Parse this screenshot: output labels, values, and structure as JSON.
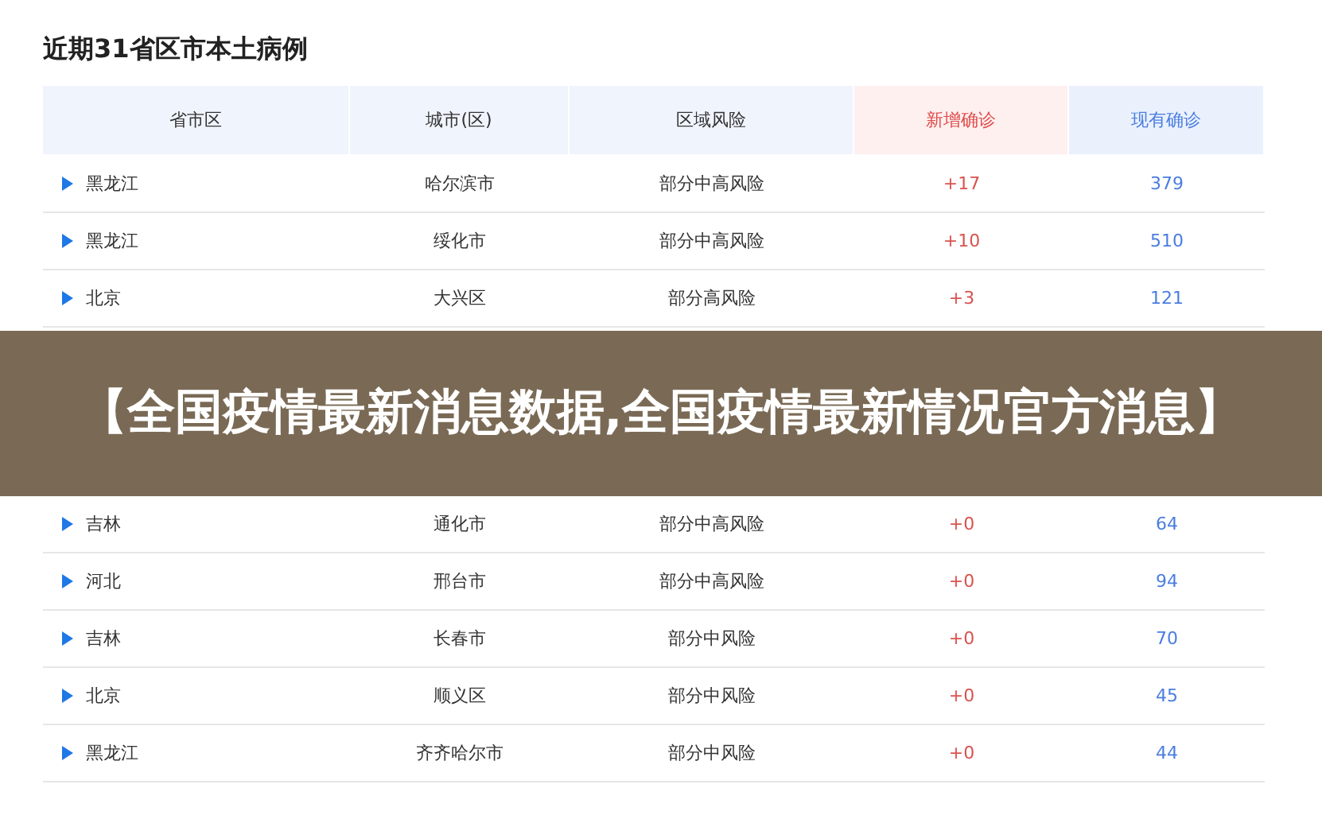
{
  "title": "近期31省区市本土病例",
  "table": {
    "columns": [
      {
        "label": "省市区",
        "kind": "plain"
      },
      {
        "label": "城市(区)",
        "kind": "plain"
      },
      {
        "label": "区域风险",
        "kind": "plain"
      },
      {
        "label": "新增确诊",
        "kind": "new"
      },
      {
        "label": "现有确诊",
        "kind": "current"
      }
    ],
    "rows": [
      {
        "province": "黑龙江",
        "city": "哈尔滨市",
        "risk": "部分中高风险",
        "new": "+17",
        "current": "379"
      },
      {
        "province": "黑龙江",
        "city": "绥化市",
        "risk": "部分中高风险",
        "new": "+10",
        "current": "510"
      },
      {
        "province": "北京",
        "city": "大兴区",
        "risk": "部分高风险",
        "new": "+3",
        "current": "121"
      }
    ]
  },
  "banner": {
    "text": "【全国疫情最新消息数据,全国疫情最新情况官方消息】"
  },
  "table_continued": {
    "rows": [
      {
        "province": "吉林",
        "city": "通化市",
        "risk": "部分中高风险",
        "new": "+0",
        "current": "64"
      },
      {
        "province": "河北",
        "city": "邢台市",
        "risk": "部分中高风险",
        "new": "+0",
        "current": "94"
      },
      {
        "province": "吉林",
        "city": "长春市",
        "risk": "部分中风险",
        "new": "+0",
        "current": "70"
      },
      {
        "province": "北京",
        "city": "顺义区",
        "risk": "部分中风险",
        "new": "+0",
        "current": "45"
      },
      {
        "province": "黑龙江",
        "city": "齐齐哈尔市",
        "risk": "部分中风险",
        "new": "+0",
        "current": "44"
      }
    ]
  }
}
